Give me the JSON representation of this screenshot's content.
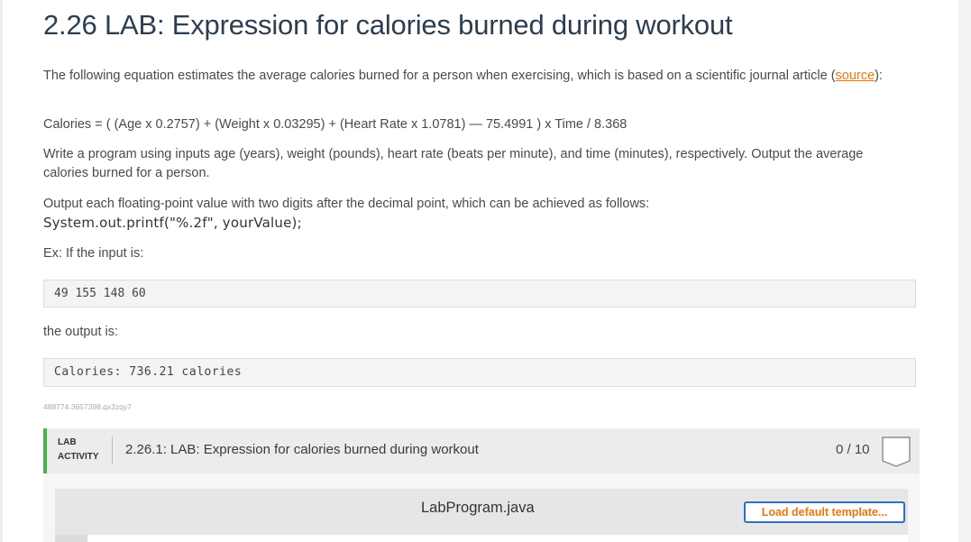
{
  "title": "2.26 LAB: Expression for calories burned during workout",
  "intro": {
    "text_before": "The following equation estimates the average calories burned for a person when exercising, which is based on a scientific journal article (",
    "link": "source",
    "text_after": "):"
  },
  "formula": "Calories = ( (Age x 0.2757) + (Weight x 0.03295) + (Heart Rate x 1.0781) — 75.4991 ) x Time / 8.368",
  "instructions": "Write a program using inputs age (years), weight (pounds), heart rate (beats per minute), and time (minutes), respectively. Output the average calories burned for a person.",
  "format_note": "Output each floating-point value with two digits after the decimal point, which can be achieved as follows:",
  "code_example": "System.out.printf(\"%.2f\", yourValue);",
  "example_label": "Ex: If the input is:",
  "example_input": "49 155 148 60",
  "output_label": "the output is:",
  "example_output": "Calories: 736.21 calories",
  "hash_id": "488774.3657398.qx3zqy7",
  "lab": {
    "tag_line1": "LAB",
    "tag_line2": "ACTIVITY",
    "title": "2.26.1: LAB: Expression for calories burned during workout",
    "score": "0 / 10",
    "accent_color": "#4cb050"
  },
  "editor": {
    "filename": "LabProgram.java",
    "load_button": "Load default template..."
  },
  "colors": {
    "link": "#e8760d",
    "title": "#2c3e50",
    "button_border": "#2f6ec4"
  }
}
